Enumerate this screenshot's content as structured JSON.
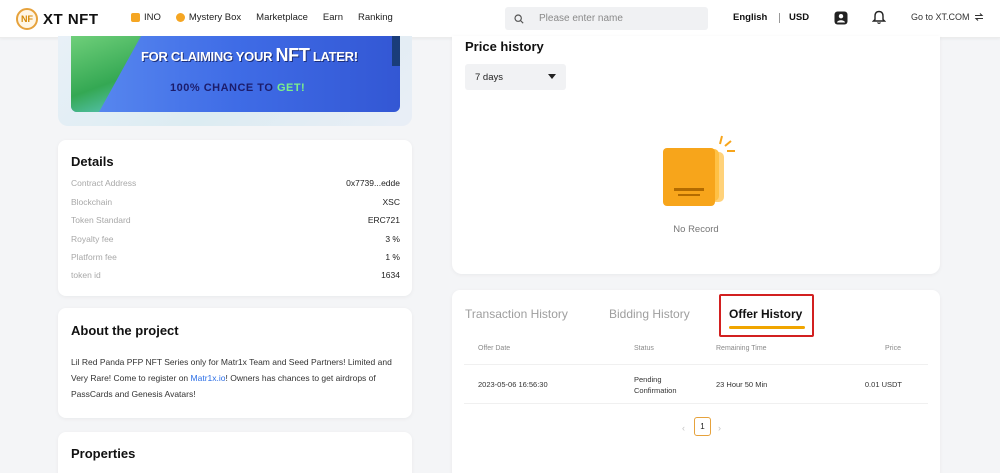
{
  "header": {
    "logo_mark": "NF",
    "logo_text": "XT NFT",
    "nav": [
      {
        "label": "INO",
        "icon": "ino-icon"
      },
      {
        "label": "Mystery Box",
        "icon": "mystery-box-icon"
      },
      {
        "label": "Marketplace"
      },
      {
        "label": "Earn"
      },
      {
        "label": "Ranking"
      }
    ],
    "search_placeholder": "Please enter name",
    "language": "English",
    "currency": "USD",
    "goto_label": "Go to XT.COM"
  },
  "banner": {
    "line1_prefix": "FOR CLAIMING YOUR ",
    "line1_nft": "NFT",
    "line1_suffix": " LATER!",
    "line2_prefix": "100% CHANCE TO ",
    "line2_highlight": "GET!"
  },
  "details": {
    "title": "Details",
    "rows": [
      {
        "key": "Contract Address",
        "value": "0x7739...edde"
      },
      {
        "key": "Blockchain",
        "value": "XSC"
      },
      {
        "key": "Token Standard",
        "value": "ERC721"
      },
      {
        "key": "Royalty fee",
        "value": "3 %"
      },
      {
        "key": "Platform fee",
        "value": "1 %"
      },
      {
        "key": "token id",
        "value": "1634"
      }
    ]
  },
  "about": {
    "title": "About the project",
    "text_before": "Lil Red Panda PFP NFT Series only for Matr1x Team and Seed Partners! Limited and Very Rare! Come to register on ",
    "link": "Matr1x.io",
    "text_after": "! Owners has chances to get airdrops of PassCards and Genesis Avatars!"
  },
  "properties": {
    "title": "Properties"
  },
  "price_history": {
    "title": "Price history",
    "range_selected": "7 days",
    "empty_text": "No Record"
  },
  "history": {
    "tabs": [
      "Transaction History",
      "Bidding History",
      "Offer History"
    ],
    "active_tab": "Offer History",
    "columns": [
      "Offer Date",
      "Status",
      "Remaining Time",
      "Price"
    ],
    "rows": [
      {
        "date": "2023-05-06 16:56:30",
        "status_line1": "Pending",
        "status_line2": "Confirmation",
        "remaining": "23 Hour 50 Min",
        "price": "0.01 USDT"
      }
    ],
    "pagination": {
      "prev": "‹",
      "current": "1",
      "next": "›"
    }
  },
  "colors": {
    "accent": "#f0a500",
    "highlight_box": "#d22020",
    "link": "#2b6ee6"
  }
}
